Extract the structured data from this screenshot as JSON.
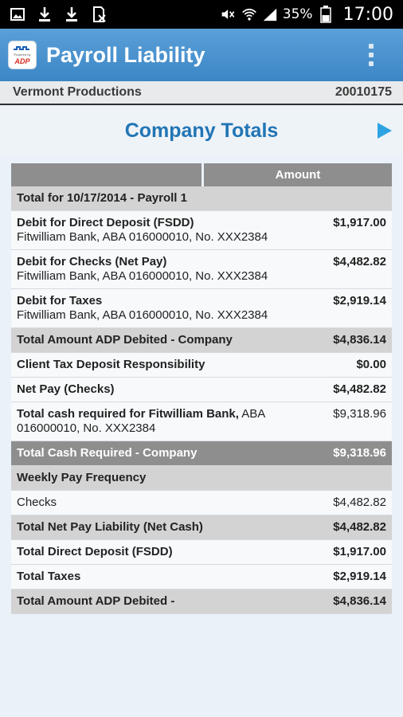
{
  "status_bar": {
    "icons_left": [
      "image-icon",
      "download-icon",
      "download-icon",
      "sd-card-icon"
    ],
    "battery": "35%",
    "time": "17:00"
  },
  "app_bar": {
    "title": "Payroll Liability",
    "logo_small_text": "Powered by",
    "logo_brand": "ADP"
  },
  "company": {
    "name": "Vermont Productions",
    "id": "20010175"
  },
  "section": {
    "title": "Company Totals"
  },
  "table": {
    "header_amount": "Amount",
    "rows": [
      {
        "label": "Total for 10/17/2014 - Payroll 1",
        "amount": "",
        "style": "grey"
      },
      {
        "label": "Debit for Direct Deposit (FSDD)",
        "sub": "Fitwilliam Bank, ABA 016000010, No. XXX2384",
        "amount": "$1,917.00",
        "style": "white"
      },
      {
        "label": "Debit for Checks (Net Pay)",
        "sub": "Fitwilliam Bank, ABA 016000010, No. XXX2384",
        "amount": "$4,482.82",
        "style": "white"
      },
      {
        "label": "Debit for Taxes",
        "sub": "Fitwilliam Bank, ABA 016000010, No. XXX2384",
        "amount": "$2,919.14",
        "style": "white"
      },
      {
        "label": "Total Amount ADP Debited - Company",
        "amount": "$4,836.14",
        "style": "grey"
      },
      {
        "label": "Client Tax Deposit Responsibility",
        "amount": "$0.00",
        "style": "white"
      },
      {
        "label": "Net Pay (Checks)",
        "amount": "$4,482.82",
        "style": "white"
      },
      {
        "label": "Total cash required for Fitwilliam Bank,",
        "sub": "ABA 016000010, No. XXX2384",
        "amount": "$9,318.96",
        "style": "white"
      },
      {
        "label": "Total Cash Required - Company",
        "amount": "$9,318.96",
        "style": "dark"
      },
      {
        "label": "Weekly Pay Frequency",
        "amount": "",
        "style": "grey"
      },
      {
        "label": "Checks",
        "amount": "$4,482.82",
        "style": "white"
      },
      {
        "label": "Total Net Pay Liability (Net Cash)",
        "amount": "$4,482.82",
        "style": "grey"
      },
      {
        "label": "Total Direct Deposit (FSDD)",
        "amount": "$1,917.00",
        "style": "white"
      },
      {
        "label": "Total Taxes",
        "amount": "$2,919.14",
        "style": "white"
      },
      {
        "label": "Total Amount ADP Debited -",
        "amount": "$4,836.14",
        "style": "grey"
      }
    ]
  }
}
